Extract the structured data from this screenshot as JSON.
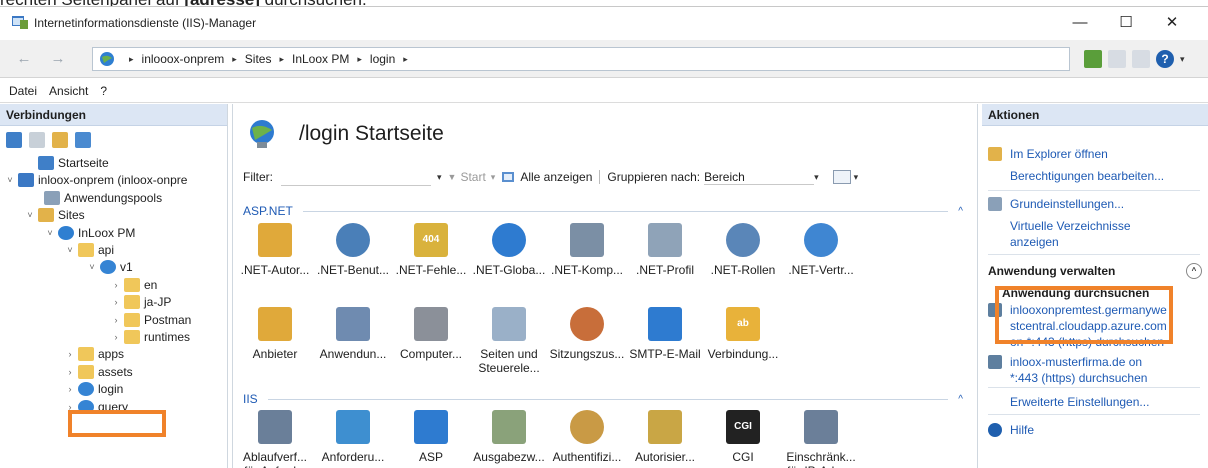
{
  "caption": {
    "prefix": "rechten Seitenpanel auf ",
    "bold": "[adresse]",
    "suffix": " durchsuchen."
  },
  "window": {
    "title": "Internetinformationsdienste (IIS)-Manager",
    "controls": {
      "minimize": "—",
      "maximize": "☐",
      "close": "✕"
    }
  },
  "address": {
    "back": "←",
    "forward": "→",
    "breadcrumbs": [
      "inlooox-onprem",
      "Sites",
      "InLoox PM",
      "login"
    ],
    "separator": "▸",
    "help_label": "?",
    "help_caret": "▾"
  },
  "menu": [
    "Datei",
    "Ansicht",
    "?"
  ],
  "connections": {
    "title": "Verbindungen",
    "tree": [
      {
        "label": "Startseite",
        "twisty": "",
        "icon": "start-page-icon"
      },
      {
        "label": "inloox-onprem (inloox-onpre",
        "twisty": "˅",
        "icon": "server-icon"
      },
      {
        "label": "Anwendungspools",
        "twisty": "",
        "icon": "app-pools-icon"
      },
      {
        "label": "Sites",
        "twisty": "˅",
        "icon": "sites-folder-icon"
      },
      {
        "label": "InLoox PM",
        "twisty": "˅",
        "icon": "site-globe-icon"
      },
      {
        "label": "api",
        "twisty": "˅",
        "icon": "folder-icon"
      },
      {
        "label": "v1",
        "twisty": "˅",
        "icon": "app-globe-icon"
      },
      {
        "label": "en",
        "twisty": "›",
        "icon": "folder-icon"
      },
      {
        "label": "ja-JP",
        "twisty": "›",
        "icon": "folder-icon"
      },
      {
        "label": "Postman",
        "twisty": "›",
        "icon": "folder-icon"
      },
      {
        "label": "runtimes",
        "twisty": "›",
        "icon": "folder-icon"
      },
      {
        "label": "apps",
        "twisty": "›",
        "icon": "folder-icon"
      },
      {
        "label": "assets",
        "twisty": "›",
        "icon": "folder-icon"
      },
      {
        "label": "login",
        "twisty": "›",
        "icon": "app-globe-icon"
      },
      {
        "label": "query",
        "twisty": "›",
        "icon": "app-globe-icon"
      }
    ]
  },
  "center": {
    "title": "/login Startseite",
    "filter": {
      "label": "Filter:",
      "start": "Start",
      "show_all": "Alle anzeigen",
      "group_by": "Gruppieren nach:",
      "group_value": "Bereich",
      "caret": "▾",
      "start_icon": "▼"
    },
    "sections": [
      {
        "name": "ASP.NET",
        "caret": "^",
        "rows": [
          [
            {
              "label": ".NET-Autor...",
              "lines": [
                ".NET-Autor..."
              ],
              "icon": "net-authorization-icon"
            },
            {
              "label": ".NET-Benut...",
              "lines": [
                ".NET-Benut..."
              ],
              "icon": "net-users-icon"
            },
            {
              "label": ".NET-Fehle...",
              "lines": [
                ".NET-Fehle..."
              ],
              "icon": "net-error-pages-icon",
              "badge": "404"
            },
            {
              "label": ".NET-Globa...",
              "lines": [
                ".NET-Globa..."
              ],
              "icon": "net-globalization-icon"
            },
            {
              "label": ".NET-Komp...",
              "lines": [
                ".NET-Komp..."
              ],
              "icon": "net-compilation-icon"
            },
            {
              "label": ".NET-Profil",
              "lines": [
                ".NET-Profil"
              ],
              "icon": "net-profile-icon"
            },
            {
              "label": ".NET-Rollen",
              "lines": [
                ".NET-Rollen"
              ],
              "icon": "net-roles-icon"
            },
            {
              "label": ".NET-Vertr...",
              "lines": [
                ".NET-Vertr..."
              ],
              "icon": "net-trust-levels-icon"
            }
          ],
          [
            {
              "label": "Anbieter",
              "lines": [
                "Anbieter"
              ],
              "icon": "providers-icon"
            },
            {
              "label": "Anwendun...",
              "lines": [
                "Anwendun..."
              ],
              "icon": "app-settings-icon"
            },
            {
              "label": "Computer...",
              "lines": [
                "Computer..."
              ],
              "icon": "machine-key-icon"
            },
            {
              "label": "Seiten und Steuerele...",
              "lines": [
                "Seiten und",
                "Steuerele..."
              ],
              "icon": "pages-controls-icon"
            },
            {
              "label": "Sitzungszus...",
              "lines": [
                "Sitzungszus..."
              ],
              "icon": "session-state-icon"
            },
            {
              "label": "SMTP-E-Mail",
              "lines": [
                "SMTP-E-Mail"
              ],
              "icon": "smtp-email-icon"
            },
            {
              "label": "Verbindung...",
              "lines": [
                "Verbindung..."
              ],
              "icon": "connection-strings-icon",
              "badge": "ab"
            }
          ]
        ]
      },
      {
        "name": "IIS",
        "caret": "^",
        "rows": [
          [
            {
              "label": "Ablaufverf... für Anford...",
              "lines": [
                "Ablaufverf...",
                "für Anford..."
              ],
              "icon": "failed-request-tracing-icon"
            },
            {
              "label": "Anforderu...",
              "lines": [
                "Anforderu..."
              ],
              "icon": "request-filtering-icon"
            },
            {
              "label": "ASP",
              "lines": [
                "ASP"
              ],
              "icon": "asp-icon"
            },
            {
              "label": "Ausgabezw...",
              "lines": [
                "Ausgabezw..."
              ],
              "icon": "output-caching-icon"
            },
            {
              "label": "Authentifizi...",
              "lines": [
                "Authentifizi..."
              ],
              "icon": "authentication-icon"
            },
            {
              "label": "Autorisier...",
              "lines": [
                "Autorisier..."
              ],
              "icon": "authorization-rules-icon"
            },
            {
              "label": "CGI",
              "lines": [
                "CGI"
              ],
              "icon": "cgi-icon",
              "badge": "CGI"
            },
            {
              "label": "Einschränk... für IP-Adre...",
              "lines": [
                "Einschränk...",
                "für IP-Adre..."
              ],
              "icon": "ip-restrictions-icon"
            }
          ]
        ]
      }
    ]
  },
  "actions": {
    "title": "Aktionen",
    "items_top": [
      {
        "label": "Im Explorer öffnen",
        "icon": "explore-icon"
      },
      {
        "label": "Berechtigungen bearbeiten...",
        "icon": ""
      }
    ],
    "items_mid": [
      {
        "label": "Grundeinstellungen...",
        "icon": "basic-settings-icon"
      },
      {
        "label": "Virtuelle Verzeichnisse anzeigen",
        "icon": ""
      }
    ],
    "manage_group": "Anwendung verwalten",
    "collapse_glyph": "^",
    "browse_head": "Anwendung durchsuchen",
    "browse_links": [
      {
        "label": "inlooxonpremtest.germanywestcentral.cloudapp.azure.com on *:443 (https) durchsuchen",
        "lines": [
          "inlooxonpremtest.germanywe",
          "stcentral.cloudapp.azure.com",
          "on *:443 (https) durchsuchen"
        ],
        "icon": "browse-icon"
      },
      {
        "label": "inloox-musterfirma.de on *:443 (https) durchsuchen",
        "lines": [
          "inloox-musterfirma.de on",
          "*:443 (https) durchsuchen"
        ],
        "icon": "browse-icon"
      }
    ],
    "advanced": "Erweiterte Einstellungen...",
    "help": "Hilfe"
  },
  "colors": {
    "accent": "#1e5ab4",
    "highlight": "#f0822a",
    "panel_header": "#dce6f4"
  }
}
